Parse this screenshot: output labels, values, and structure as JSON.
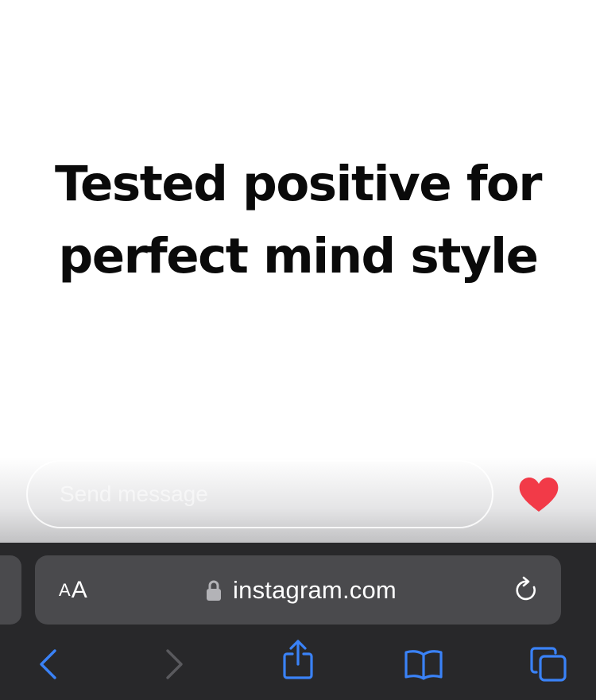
{
  "post": {
    "headline_line1": "Tested positive for",
    "headline_line2": "perfect mind style"
  },
  "reply": {
    "placeholder": "Send message",
    "like_icon": "heart-icon",
    "like_color": "#f23a48"
  },
  "browser": {
    "text_size_small": "A",
    "text_size_large": "A",
    "url": "instagram.com",
    "lock_icon": "lock-icon",
    "reload_icon": "reload-icon",
    "accent_color": "#3a82f7",
    "toolbar": {
      "back_icon": "chevron-left-icon",
      "forward_icon": "chevron-right-icon",
      "share_icon": "share-icon",
      "bookmarks_icon": "book-icon",
      "tabs_icon": "tabs-icon"
    }
  }
}
